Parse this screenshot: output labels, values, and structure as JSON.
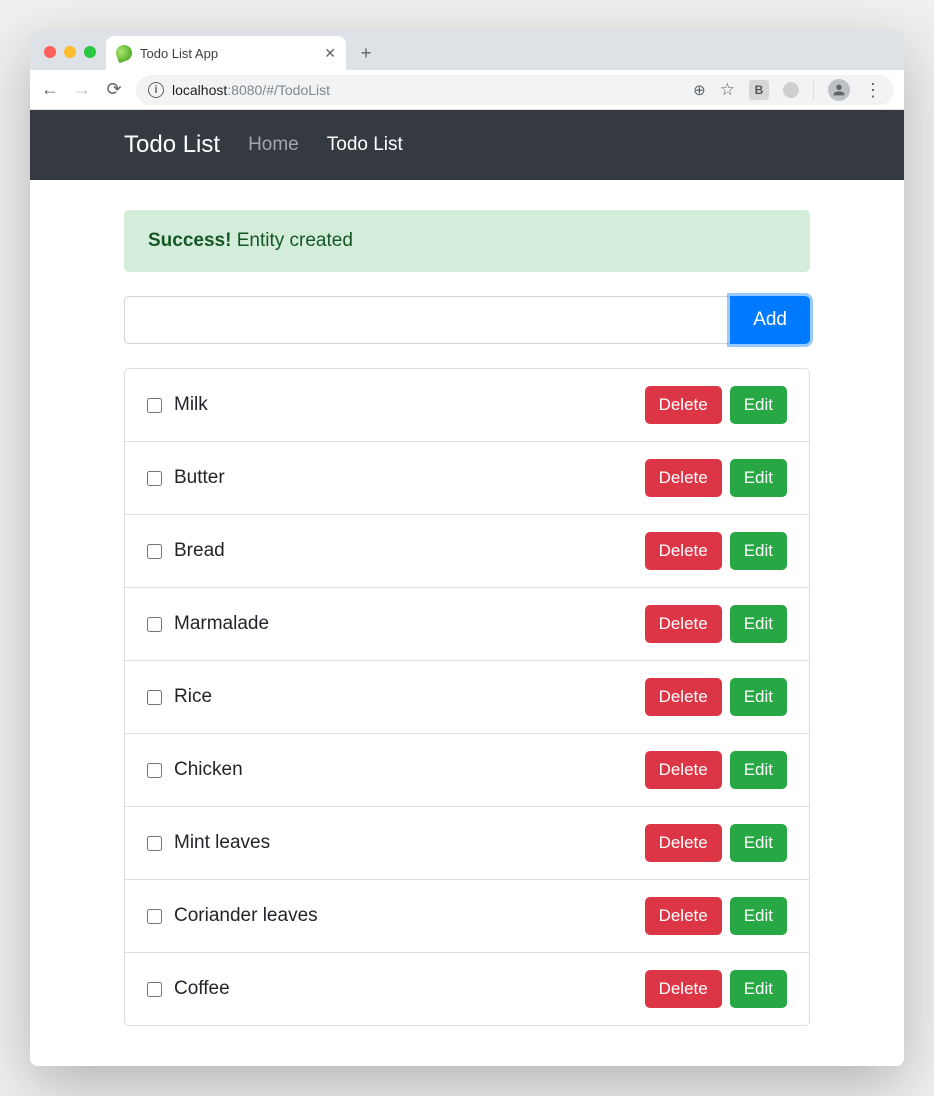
{
  "browser": {
    "tab_title": "Todo List App",
    "url_host": "localhost",
    "url_rest": ":8080/#/TodoList"
  },
  "navbar": {
    "brand": "Todo List",
    "links": [
      {
        "label": "Home",
        "active": false
      },
      {
        "label": "Todo List",
        "active": true
      }
    ]
  },
  "alert": {
    "strong": "Success!",
    "message": "Entity created"
  },
  "add": {
    "value": "",
    "button_label": "Add"
  },
  "item_buttons": {
    "delete": "Delete",
    "edit": "Edit"
  },
  "items": [
    {
      "label": "Milk",
      "checked": false
    },
    {
      "label": "Butter",
      "checked": false
    },
    {
      "label": "Bread",
      "checked": false
    },
    {
      "label": "Marmalade",
      "checked": false
    },
    {
      "label": "Rice",
      "checked": false
    },
    {
      "label": "Chicken",
      "checked": false
    },
    {
      "label": "Mint leaves",
      "checked": false
    },
    {
      "label": "Coriander leaves",
      "checked": false
    },
    {
      "label": "Coffee",
      "checked": false
    }
  ]
}
